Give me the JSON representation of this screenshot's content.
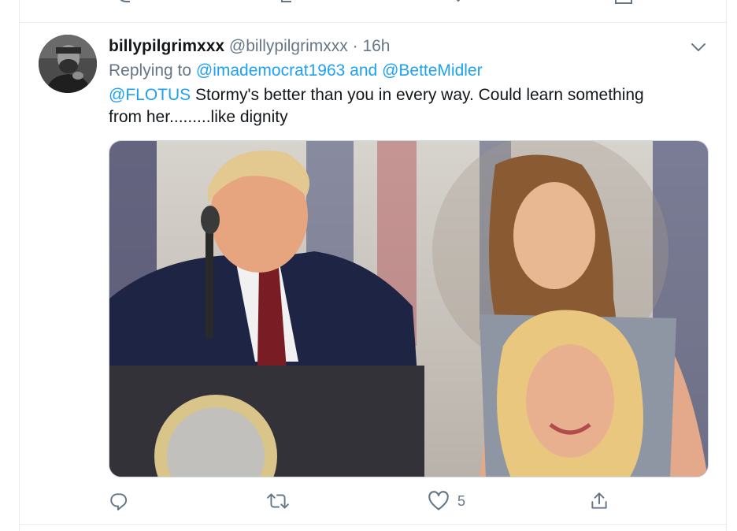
{
  "tweet": {
    "display_name": "billypilgrimxxx",
    "handle": "@billypilgrimxxx",
    "separator": "·",
    "time": "16h",
    "replying_prefix": "Replying to",
    "reply_to_1": "@imademocrat1963",
    "reply_and": "and",
    "reply_to_2": "@BetteMidler",
    "mention": "@FLOTUS",
    "text": " Stormy's better than you in every way. Could learn something from her.........like dignity",
    "like_count": "5"
  },
  "icons": {
    "caret": "chevron-down-icon",
    "reply": "reply-icon",
    "retweet": "retweet-icon",
    "like": "heart-icon",
    "share": "share-icon"
  },
  "colors": {
    "link": "#1da1f2",
    "muted": "#657786",
    "border": "#e6ecf0"
  }
}
